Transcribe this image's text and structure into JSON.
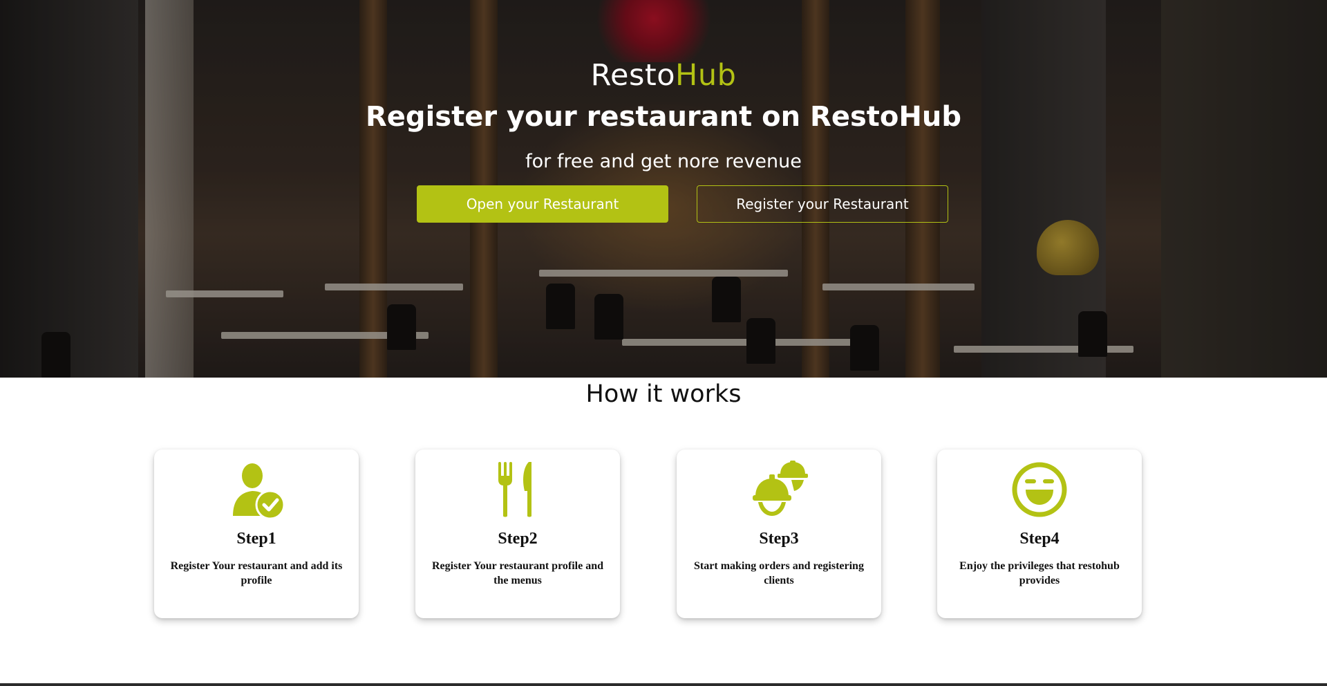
{
  "brand": {
    "part1": "Resto",
    "part2": "Hub",
    "accent_color": "#b3c214"
  },
  "hero": {
    "headline": "Register your restaurant on RestoHub",
    "subline": "for free and get nore revenue",
    "primary_button": "Open your Restaurant",
    "secondary_button": "Register your Restaurant"
  },
  "how_it_works": {
    "title": "How it works",
    "steps": [
      {
        "title": "Step1",
        "description": "Register Your restaurant and add its profile",
        "icon": "user-check-icon"
      },
      {
        "title": "Step2",
        "description": "Register Your restaurant profile and the menus",
        "icon": "fork-knife-icon"
      },
      {
        "title": "Step3",
        "description": "Start making orders and registering clients",
        "icon": "helmet-icon"
      },
      {
        "title": "Step4",
        "description": "Enjoy the privileges that restohub provides",
        "icon": "laughing-face-icon"
      }
    ]
  }
}
